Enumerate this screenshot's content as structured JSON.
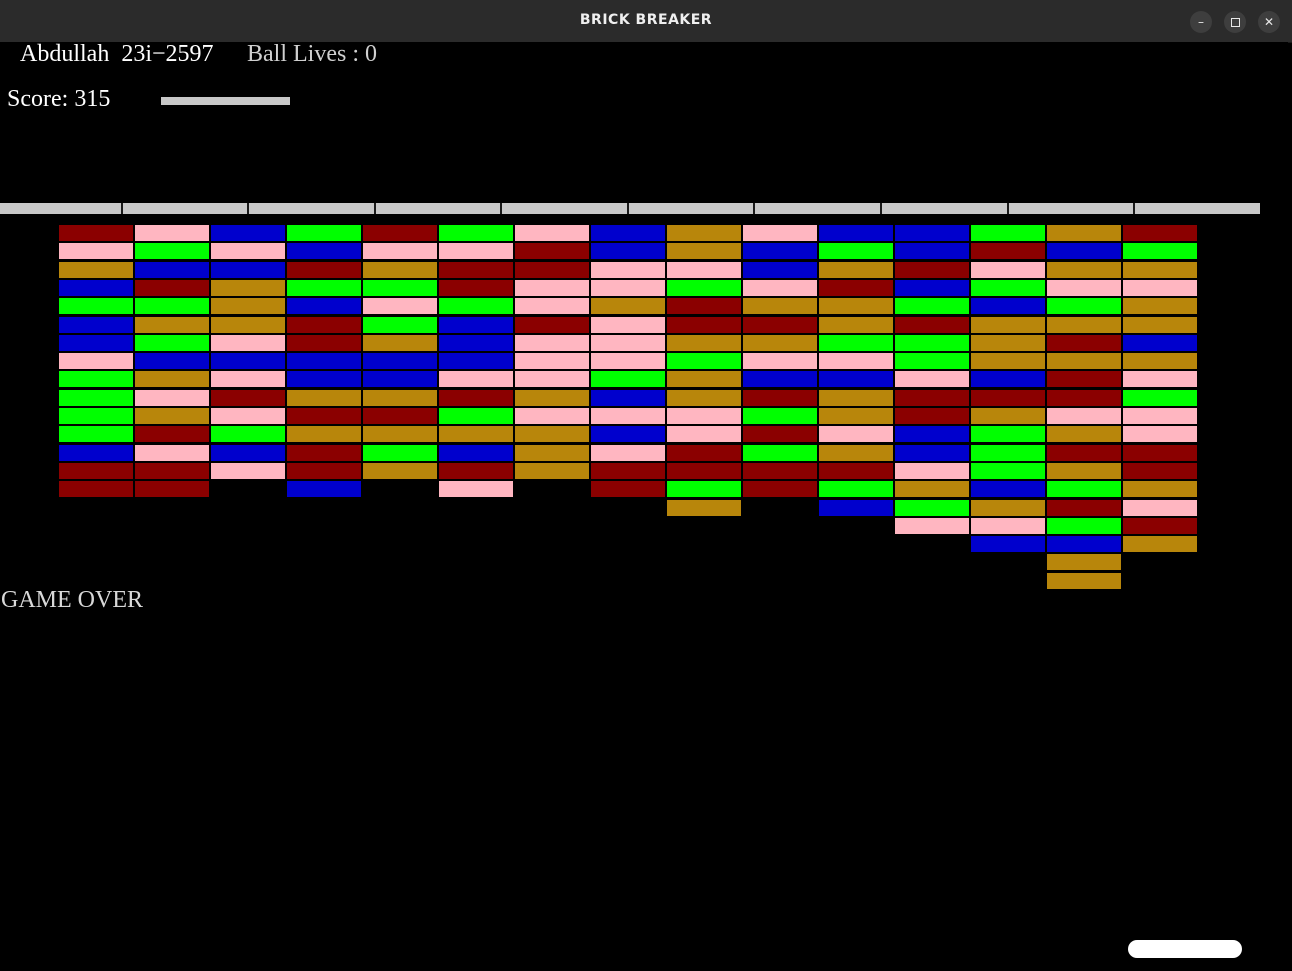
{
  "window": {
    "title": "BRICK BREAKER",
    "controls": {
      "minimize": "–",
      "close": "✕"
    }
  },
  "hud": {
    "player": "Abdullah  23i−2597",
    "lives": "Ball Lives : 0",
    "score": "Score: 315"
  },
  "status": {
    "game_over": "GAME OVER"
  },
  "colors": {
    "R": "#8b0000",
    "P": "#ffb6c1",
    "B": "#0000cd",
    "G": "#00ff00",
    "O": "#b8860b",
    "background": "#000000",
    "wall": "#c8c8c8",
    "paddle": "#ffffff"
  },
  "brick_grid": [
    "RPBGRGPBOPBBGOR",
    "PGPBPPRBOBGBRBG",
    "OBBRORRPPBORPOO",
    "BROGGRPPGPRBGPP",
    "GGOBPGPOROOGBGO",
    "BOORGBRPRROROOO",
    "BGPROBPPOOGGORB",
    "PBBBBBPPGPPGOOO",
    "GOPBBPPGOBBPBRP",
    "GPROOROBORORRRG",
    "GOPRRGPPPGOROPP",
    "GRGOOOOBPRPBGOP",
    "BPBRGBOPRGOBGRR",
    "RRPRORORRRRPGOR",
    "RR.B.P.RGRGOBGO",
    "........O.BGORP",
    "...........PPGR",
    "............BBO",
    ".............O.",
    ".............O."
  ]
}
